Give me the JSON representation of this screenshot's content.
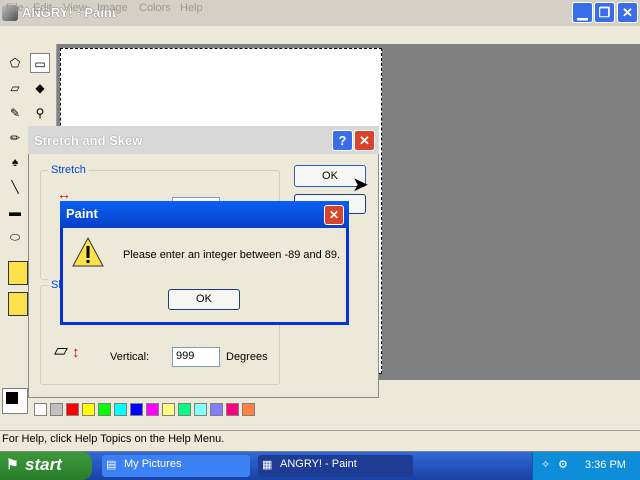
{
  "window": {
    "title": "ANGRY! - Paint"
  },
  "menu": [
    "File",
    "Edit",
    "View",
    "Image",
    "Colors",
    "Help"
  ],
  "status": {
    "text": "For Help, click Help Topics on the Help Menu."
  },
  "stretch_dialog": {
    "title": "Stretch and Skew",
    "stretch_group": "Stretch",
    "skew_group_partial": "Sk",
    "ok_label": "OK",
    "vertical_label": "Vertical:",
    "vertical_value": "999",
    "vertical_unit": "Degrees"
  },
  "message_box": {
    "title": "Paint",
    "text": "Please enter an integer between -89 and 89.",
    "ok_label": "OK"
  },
  "taskbar": {
    "start_label": "start",
    "tasks": [
      "My Pictures",
      "ANGRY! - Paint"
    ],
    "clock": "3:36 PM"
  },
  "palette": {
    "colors": [
      "#ffffff",
      "#c0c0c0",
      "#ff0000",
      "#ffff00",
      "#00ff00",
      "#00ffff",
      "#0000ff",
      "#ff00ff",
      "#ffff80",
      "#00ff80",
      "#80ffff",
      "#8080ff",
      "#ff0080",
      "#ff8040"
    ]
  },
  "icons": [
    "free-form-select-icon",
    "select-icon",
    "eraser-icon",
    "fill-icon",
    "pick-color-icon",
    "magnifier-icon",
    "pencil-icon",
    "brush-icon",
    "airbrush-icon",
    "text-icon",
    "line-icon",
    "curve-icon",
    "rectangle-icon",
    "polygon-icon",
    "ellipse-icon",
    "rounded-rect-icon",
    "warning-icon",
    "help-icon",
    "close-icon"
  ]
}
